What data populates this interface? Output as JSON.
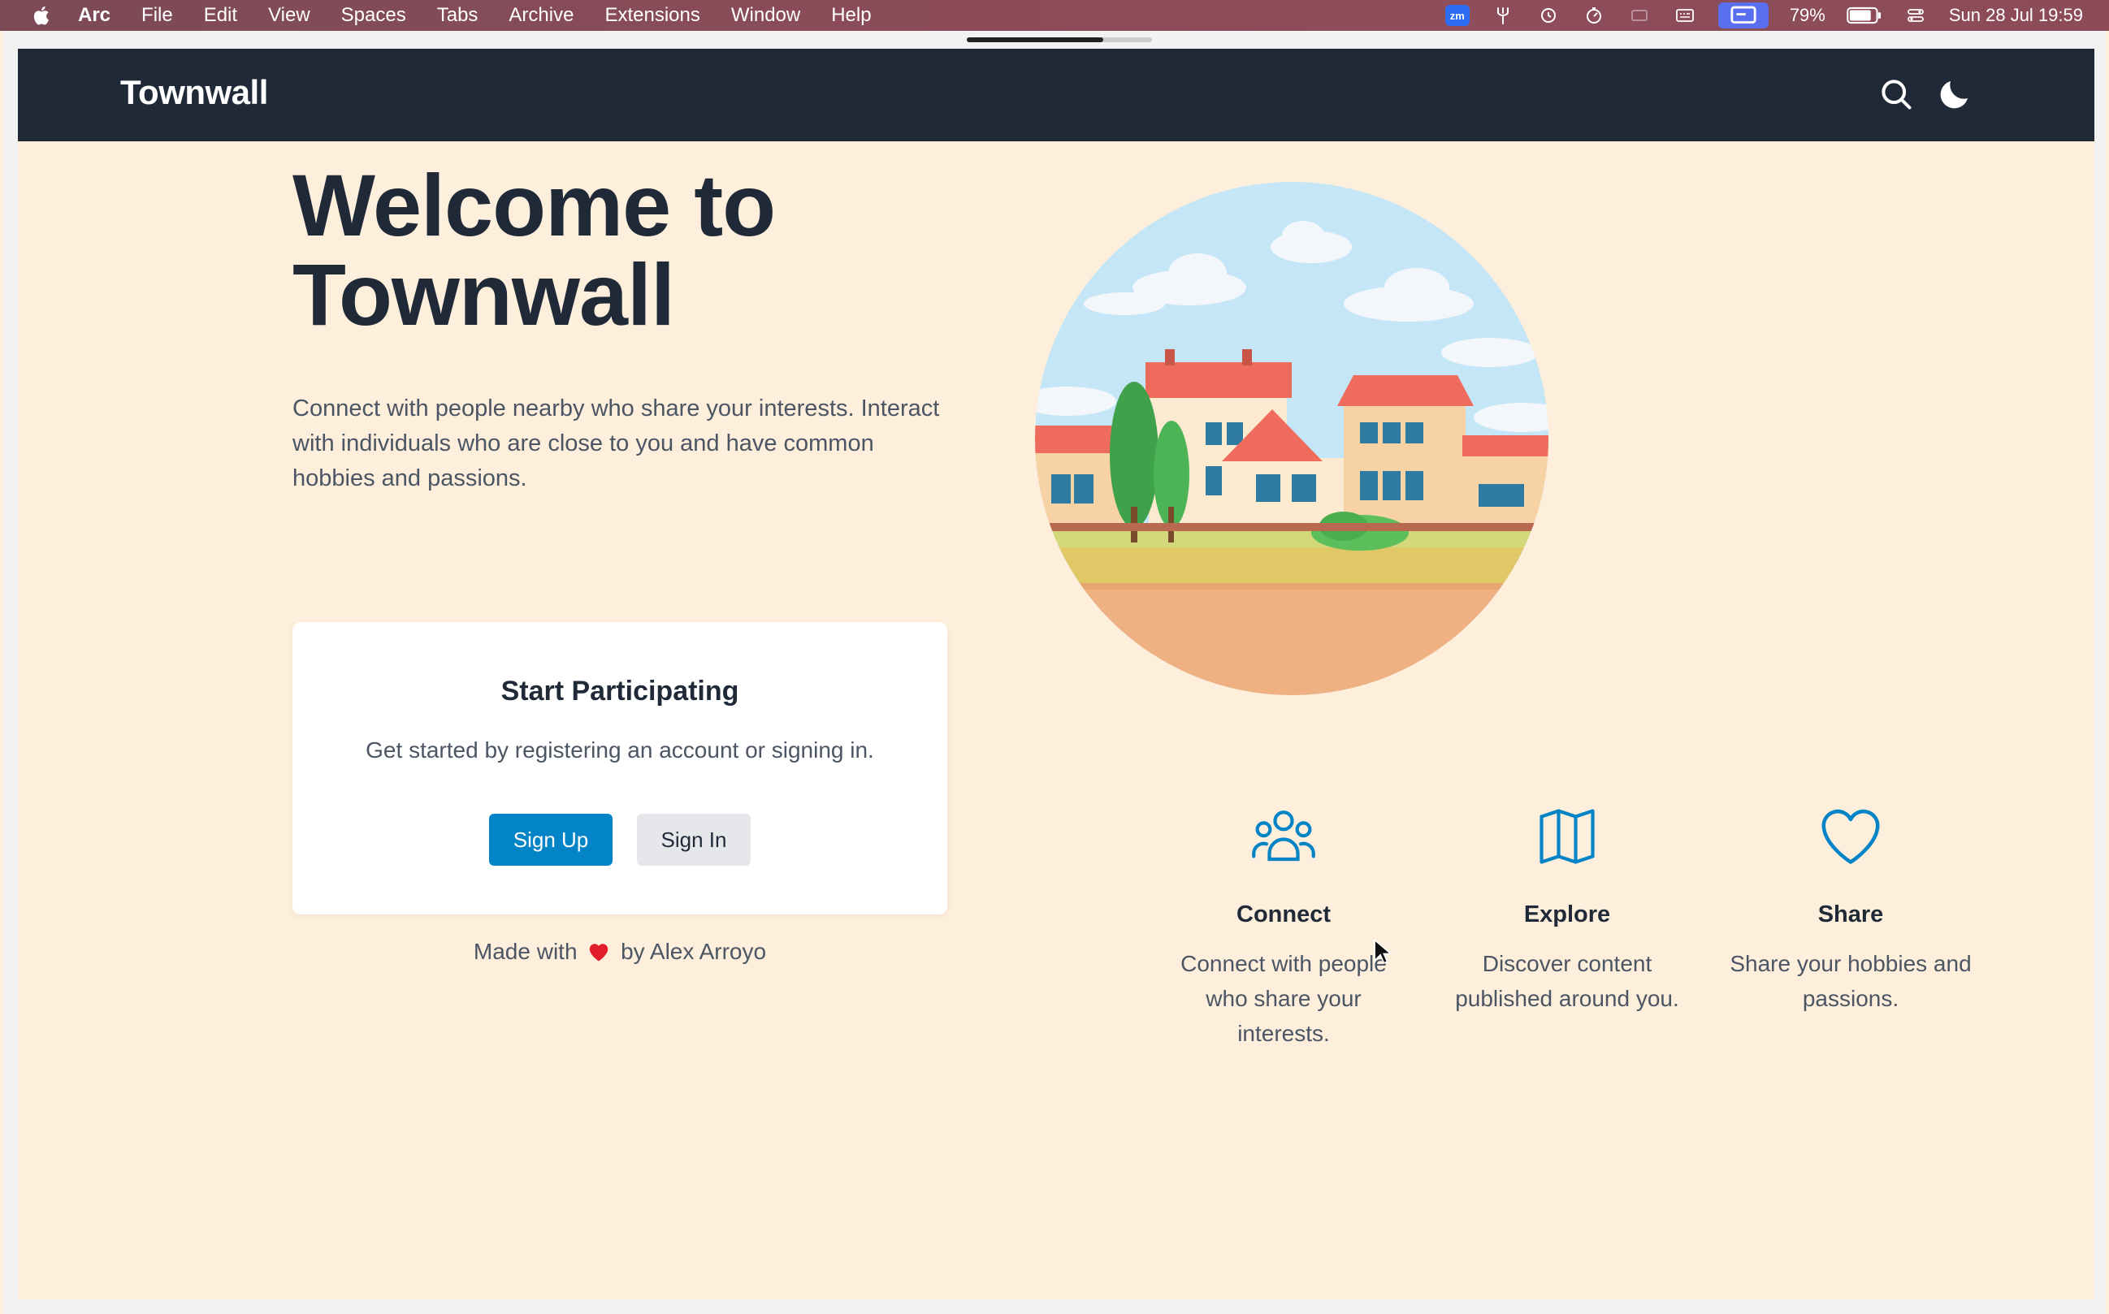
{
  "menubar": {
    "items": [
      "Arc",
      "File",
      "Edit",
      "View",
      "Spaces",
      "Tabs",
      "Archive",
      "Extensions",
      "Window",
      "Help"
    ],
    "battery": "79%",
    "datetime": "Sun 28 Jul  19:59",
    "zoom_badge": "zm"
  },
  "navbar": {
    "brand": "Townwall",
    "search_icon": "search-icon",
    "theme_icon": "moon-icon"
  },
  "hero": {
    "title": "Welcome to Townwall",
    "subtitle": "Connect with people nearby who share your interests. Interact with individuals who are close to you and have common hobbies and passions."
  },
  "card": {
    "title": "Start Participating",
    "subtitle": "Get started by registering an account or signing in.",
    "signup_label": "Sign Up",
    "signin_label": "Sign In"
  },
  "footer": {
    "made_with_prefix": "Made with",
    "made_with_suffix": "by Alex Arroyo"
  },
  "features": [
    {
      "icon": "people-group-icon",
      "title": "Connect",
      "desc": "Connect with people who share your interests."
    },
    {
      "icon": "map-icon",
      "title": "Explore",
      "desc": "Discover content published around you."
    },
    {
      "icon": "heart-icon",
      "title": "Share",
      "desc": "Share your hobbies and passions."
    }
  ],
  "colors": {
    "navbar_bg": "#1f2937",
    "page_bg": "#fdefdb",
    "primary": "#0284c7",
    "icon_accent": "#0284c7"
  }
}
